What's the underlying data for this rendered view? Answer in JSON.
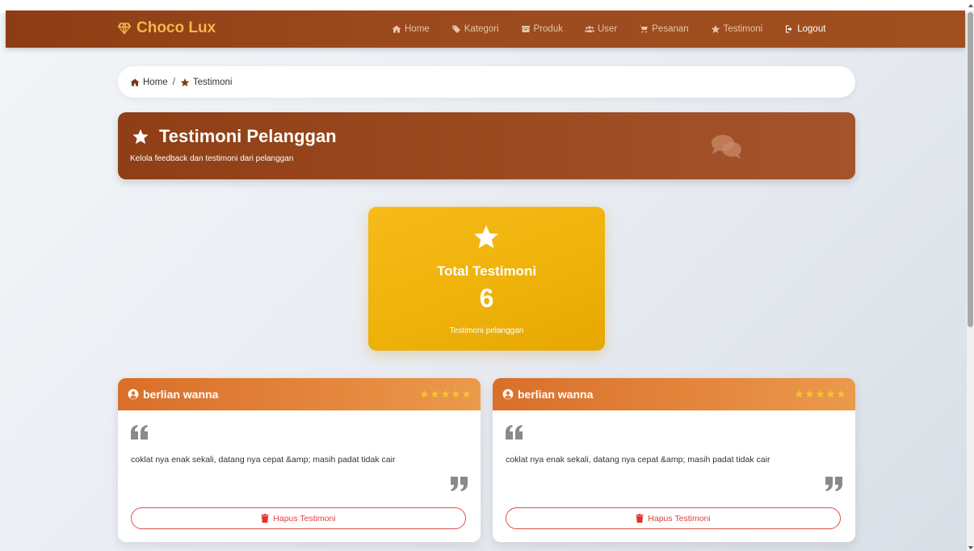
{
  "brand": {
    "name": "Choco Lux",
    "icon": "diamond-icon",
    "color": "#f6b64a"
  },
  "nav": {
    "items": [
      {
        "label": "Home",
        "icon": "home-icon"
      },
      {
        "label": "Kategori",
        "icon": "tags-icon"
      },
      {
        "label": "Produk",
        "icon": "box-icon"
      },
      {
        "label": "User",
        "icon": "users-icon"
      },
      {
        "label": "Pesanan",
        "icon": "cart-icon"
      },
      {
        "label": "Testimoni",
        "icon": "star-icon"
      }
    ],
    "logout": {
      "label": "Logout",
      "icon": "logout-icon"
    }
  },
  "breadcrumb": {
    "home": "Home",
    "current": "Testimoni"
  },
  "header": {
    "title": "Testimoni Pelanggan",
    "subtitle": "Kelola feedback dan testimoni dari pelanggan",
    "deco_icon": "comments-icon"
  },
  "stat": {
    "title": "Total Testimoni",
    "value": "6",
    "caption": "Testimoni pelanggan",
    "icon": "star-icon"
  },
  "testimonials": [
    {
      "name": "berlian wanna",
      "rating": 5,
      "text": "coklat nya enak sekali, datang nya cepat &amp; masih padat tidak cair",
      "delete_label": "Hapus Testimoni"
    },
    {
      "name": "berlian wanna",
      "rating": 5,
      "text": "coklat nya enak sekali, datang nya cepat &amp; masih padat tidak cair",
      "delete_label": "Hapus Testimoni"
    }
  ],
  "colors": {
    "navbar": "#9a4a1d",
    "header": "#9b4a20",
    "stat_card": "#f0b30c",
    "card_header": "#e4873d",
    "danger": "#e04040",
    "rating_star": "#f5c431"
  }
}
